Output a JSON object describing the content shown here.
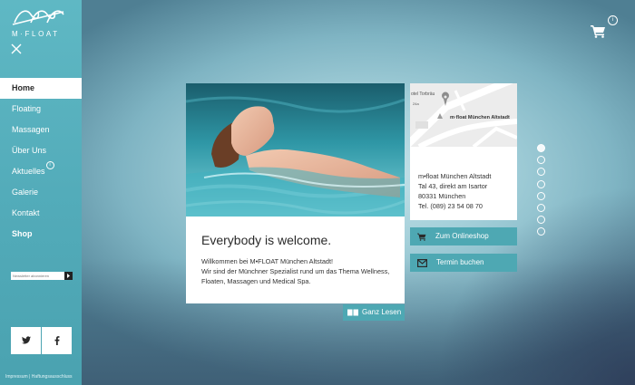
{
  "brand": {
    "name": "M·FLOAT"
  },
  "nav": {
    "items": [
      {
        "label": "Home",
        "active": true
      },
      {
        "label": "Floating"
      },
      {
        "label": "Massagen"
      },
      {
        "label": "Über Uns"
      },
      {
        "label": "Aktuelles",
        "badge": "i"
      },
      {
        "label": "Galerie"
      },
      {
        "label": "Kontakt"
      },
      {
        "label": "Shop"
      }
    ]
  },
  "newsletter": {
    "placeholder": "Newsletter abonnieren",
    "submit_icon": "arrow-right-icon"
  },
  "social": {
    "twitter_icon": "twitter-icon",
    "facebook_icon": "facebook-icon"
  },
  "footer": {
    "links": "Impressum  |  Haftungsausschluss"
  },
  "cart": {
    "icon": "cart-icon",
    "badge": "i"
  },
  "welcome": {
    "title": "Everybody is welcome.",
    "line1": "Willkommen bei M•FLOAT München Altstadt!",
    "line2": "Wir sind der Münchner Spezialist rund um das Thema Wellness, Floaten, Massagen und Medical Spa.",
    "read_more": "Ganz Lesen"
  },
  "location": {
    "map_label": "m·float München Altstadt",
    "map_street": "otel Torbräu",
    "map_small": "24a",
    "name": "m•float München Altstadt",
    "street": "Tal 43, direkt am Isartor",
    "city": "80331 München",
    "phone": "Tel. (089) 23 54 08 70"
  },
  "actions": {
    "shop": "Zum Onlineshop",
    "booking": "Termin buchen"
  },
  "slider": {
    "count": 8,
    "active_index": 0
  },
  "colors": {
    "accent": "#4ea8b3",
    "sidebar": "#55afbc"
  }
}
